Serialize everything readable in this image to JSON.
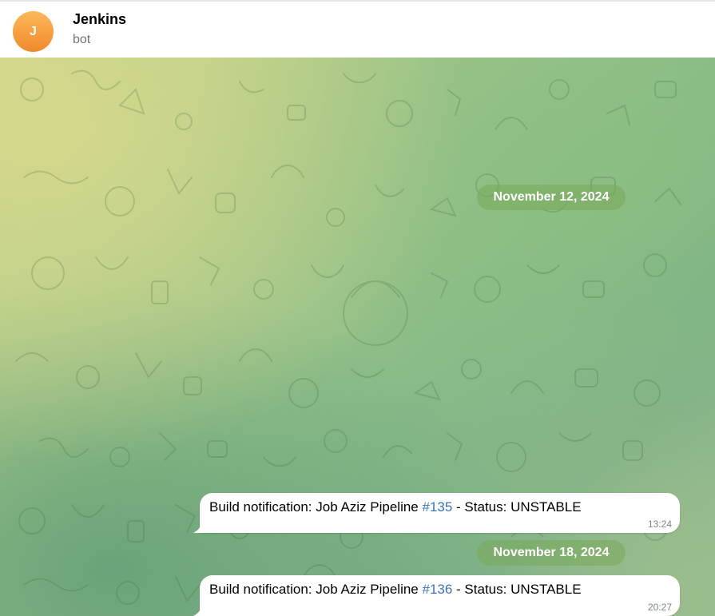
{
  "chat": {
    "avatar_letter": "J",
    "title": "Jenkins",
    "subtitle": "bot",
    "avatar_color": "#f39a3a"
  },
  "messages": [
    {
      "date": "November 12, 2024",
      "text_before": "Build notification: Job Aziz Pipeline ",
      "link": "#135",
      "text_after": " - Status: UNSTABLE",
      "time": "13:24"
    },
    {
      "date": "November 18, 2024",
      "text_before": "Build notification: Job Aziz Pipeline ",
      "link": "#136",
      "text_after": " - Status: UNSTABLE",
      "time": "20:27"
    }
  ],
  "colors": {
    "link": "#3a74b8",
    "date_badge": "#78aa5a",
    "bubble": "#ffffff"
  }
}
